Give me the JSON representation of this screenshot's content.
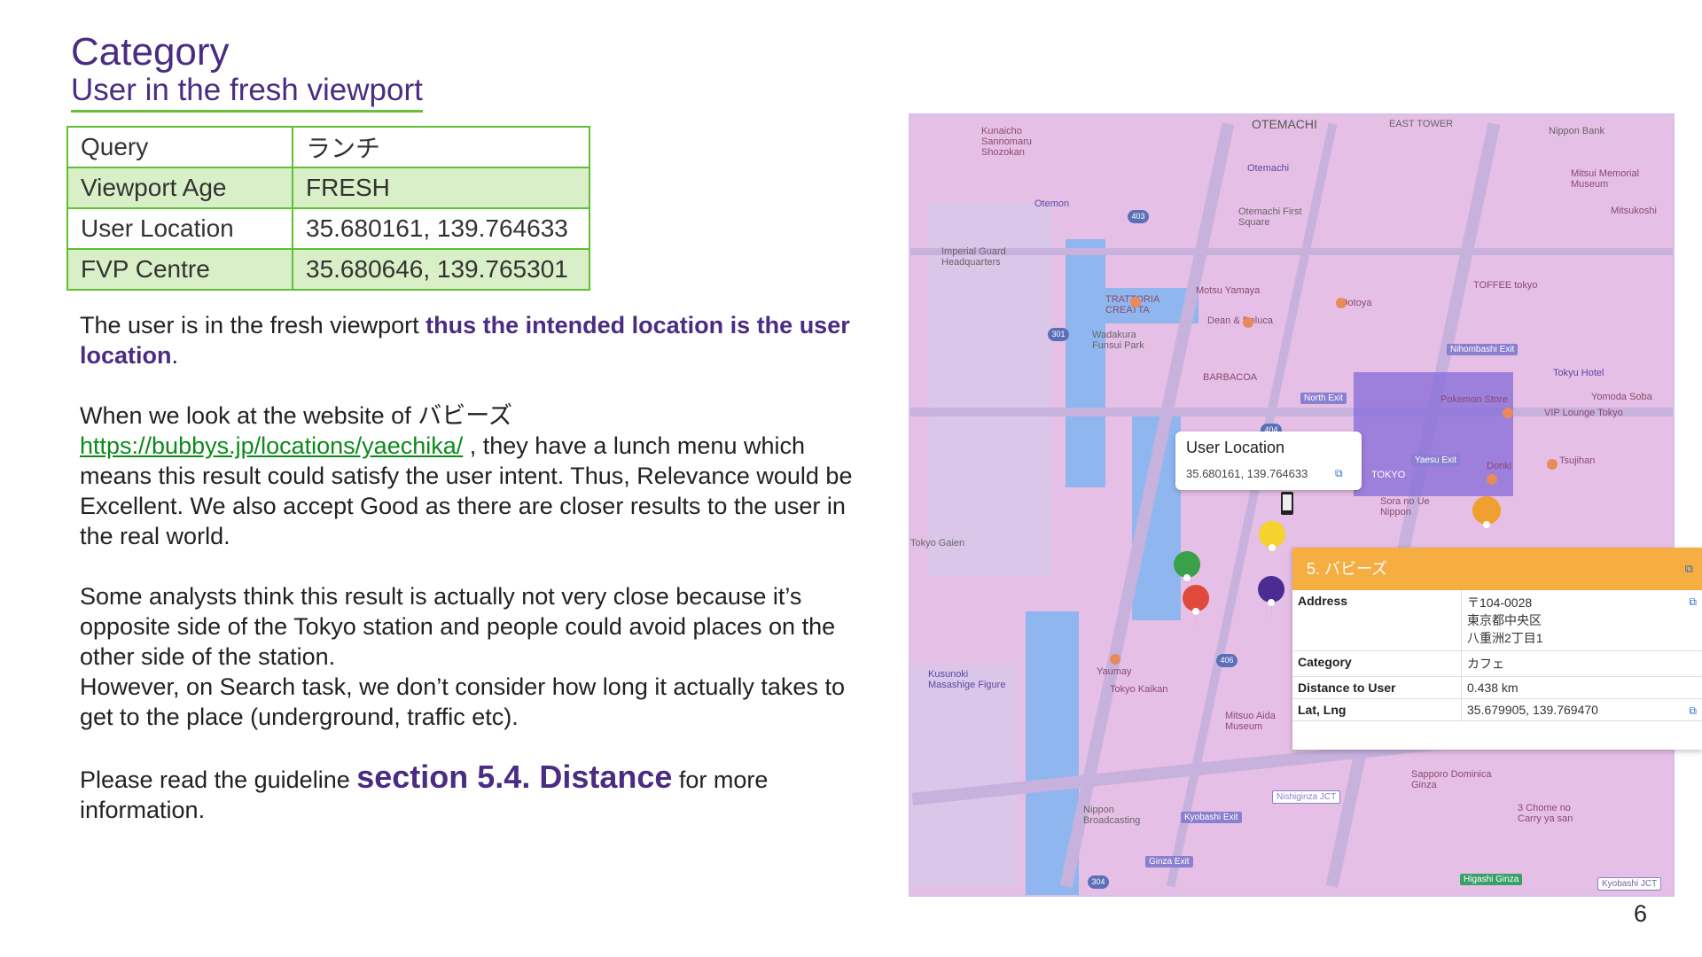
{
  "header": {
    "title": "Category",
    "subtitle": "User in the fresh viewport"
  },
  "info_table": [
    {
      "key": "Query",
      "value": "ランチ"
    },
    {
      "key": "Viewport Age",
      "value": "FRESH"
    },
    {
      "key": "User Location",
      "value": "35.680161, 139.764633"
    },
    {
      "key": "FVP Centre",
      "value": "35.680646, 139.765301"
    }
  ],
  "body": {
    "p1_a": "The user is in the fresh viewport ",
    "p1_em": "thus the intended location is the user location",
    "p1_end": ".",
    "p2_a": "When we look at the website of バビーズ",
    "p2_link": "https://bubbys.jp/locations/yaechika/",
    "p2_b": " , they have a lunch menu which means this result could satisfy the user intent. Thus, Relevance would be Excellent. We also accept Good as there are closer results to the user in the real world.",
    "p3_a": "Some analysts think this result is actually not very close because it’s opposite side of the Tokyo station and people could avoid places on the other side of the station.",
    "p3_b": "However, on Search task, we don’t consider how long it actually takes to get to the place (underground, traffic etc).",
    "p4_a": "Please read the guideline ",
    "p4_big": "section 5.4. Distance",
    "p4_b": " for more information."
  },
  "page_number": "6",
  "map": {
    "labels": {
      "otemachi_top": "OTEMACHI",
      "east_tower": "EAST TOWER",
      "nippon_bank": "Nippon Bank",
      "kunaicho": "Kunaicho Sannomaru Shozokan",
      "otemachi": "Otemachi",
      "otemachi_fs": "Otemachi First Square",
      "mitsui": "Mitsui Memorial Museum",
      "mitsukoshi": "Mitsukoshi",
      "otemon": "Otemon",
      "imperial": "Imperial Guard Headquarters",
      "trattoria": "TRATTORIA CREATTA",
      "motsu": "Motsu Yamaya",
      "dean": "Dean & Deluca",
      "ootoya": "Ootoya",
      "toffee": "TOFFEE tokyo",
      "wadakura": "Wadakura Funsui Park",
      "nihombashi_exit": "Nihombashi Exit",
      "tokyo_hotel": "Tokyu Hotel",
      "barbacoa": "BARBACOA",
      "north_exit": "North Exit",
      "pokemon": "Pokemon Store",
      "yomoda": "Yomoda Soba",
      "vip": "VIP Lounge Tokyo",
      "yaesu_exit": "Yaesu Exit",
      "donki": "Donki",
      "tsujihan": "Tsujihan",
      "sora": "Sora no Ue Nippon",
      "gaien": "Tokyo Gaien",
      "yaumay": "Yaumay",
      "tokyo_kaikan": "Tokyo Kaikan",
      "kusunoki": "Kusunoki Masashige Figure",
      "mitsuo": "Mitsuo Aida Museum",
      "sapporo": "Sapporo Dominica Ginza",
      "nishiginza": "Nishiginza JCT",
      "kyobashi": "Kyobashi Exit",
      "nippon_bc": "Nippon Broadcasting",
      "chome": "3 Chome no Carry ya san",
      "ginza_exit": "Ginza Exit",
      "higashi_ginza": "Higashi Ginza",
      "kyobashi_jct": "Kyobashi JCT",
      "tokyo": "TOKYO"
    },
    "tooltip": {
      "title": "User Location",
      "coords": "35.680161, 139.764633"
    },
    "card": {
      "title": "5. バビーズ",
      "rows": [
        {
          "key": "Address",
          "lines": [
            "〒104-0028",
            "東京都中央区",
            "八重洲2丁目1"
          ]
        },
        {
          "key": "Category",
          "lines": [
            "カフェ"
          ]
        },
        {
          "key": "Distance to User",
          "lines": [
            "0.438 km"
          ]
        },
        {
          "key": "Lat, Lng",
          "lines": [
            "35.679905, 139.769470"
          ]
        }
      ]
    }
  }
}
